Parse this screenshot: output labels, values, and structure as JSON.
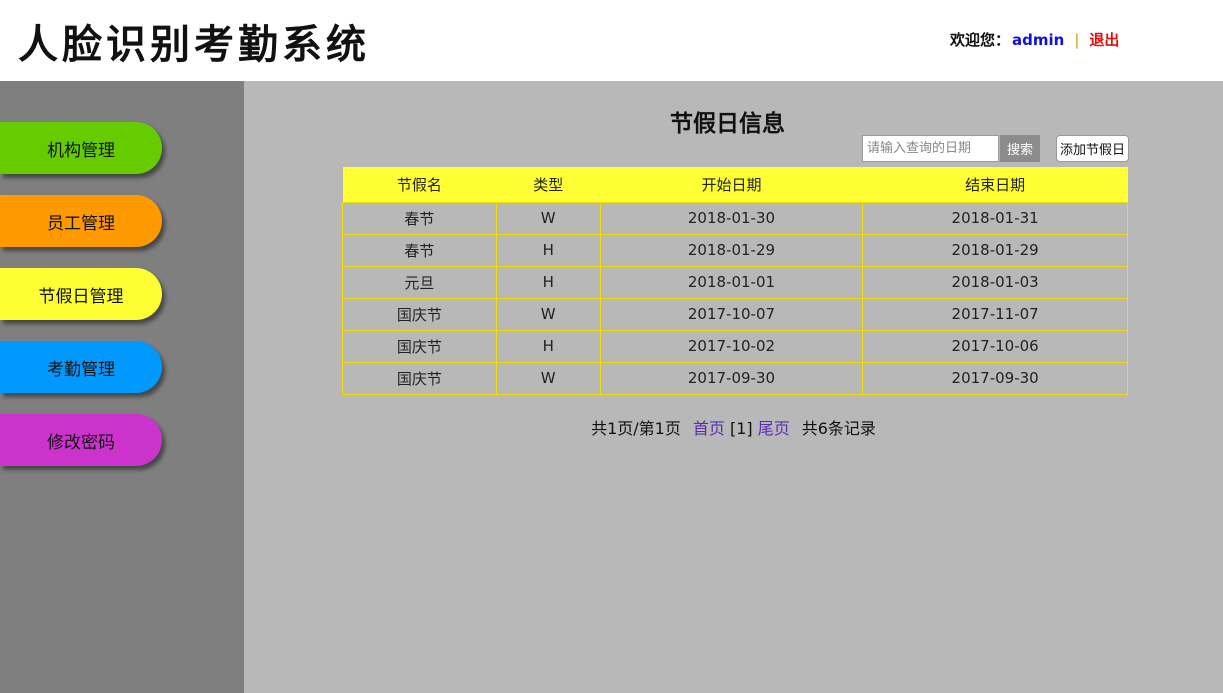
{
  "header": {
    "title": "人脸识别考勤系统",
    "welcome_label": "欢迎您：",
    "username": "admin",
    "separator": "|",
    "logout_label": "退出"
  },
  "sidebar": {
    "items": [
      {
        "label": "机构管理",
        "color": "#66cc00"
      },
      {
        "label": "员工管理",
        "color": "#ff9900"
      },
      {
        "label": "节假日管理",
        "color": "#ffff33"
      },
      {
        "label": "考勤管理",
        "color": "#0099ff"
      },
      {
        "label": "修改密码",
        "color": "#cc33cc"
      }
    ]
  },
  "main": {
    "title": "节假日信息",
    "search_placeholder": "请输入查询的日期",
    "search_label": "搜索",
    "add_label": "添加节假日",
    "table": {
      "headers": [
        "节假名",
        "类型",
        "开始日期",
        "结束日期"
      ],
      "rows": [
        [
          "春节",
          "W",
          "2018-01-30",
          "2018-01-31"
        ],
        [
          "春节",
          "H",
          "2018-01-29",
          "2018-01-29"
        ],
        [
          "元旦",
          "H",
          "2018-01-01",
          "2018-01-03"
        ],
        [
          "国庆节",
          "W",
          "2017-10-07",
          "2017-11-07"
        ],
        [
          "国庆节",
          "H",
          "2017-10-02",
          "2017-10-06"
        ],
        [
          "国庆节",
          "W",
          "2017-09-30",
          "2017-09-30"
        ]
      ]
    },
    "pagination": {
      "page_info": "共1页/第1页",
      "first_label": "首页",
      "current_label": "[1]",
      "last_label": "尾页",
      "total_label": "共6条记录"
    }
  },
  "colors": {
    "sidebar_bg": "#7f7f7f",
    "main_bg": "#b8b8b8",
    "table_header": "#ffff33",
    "table_border": "#f0e000",
    "username": "#1010dd",
    "logout": "#e01010"
  }
}
